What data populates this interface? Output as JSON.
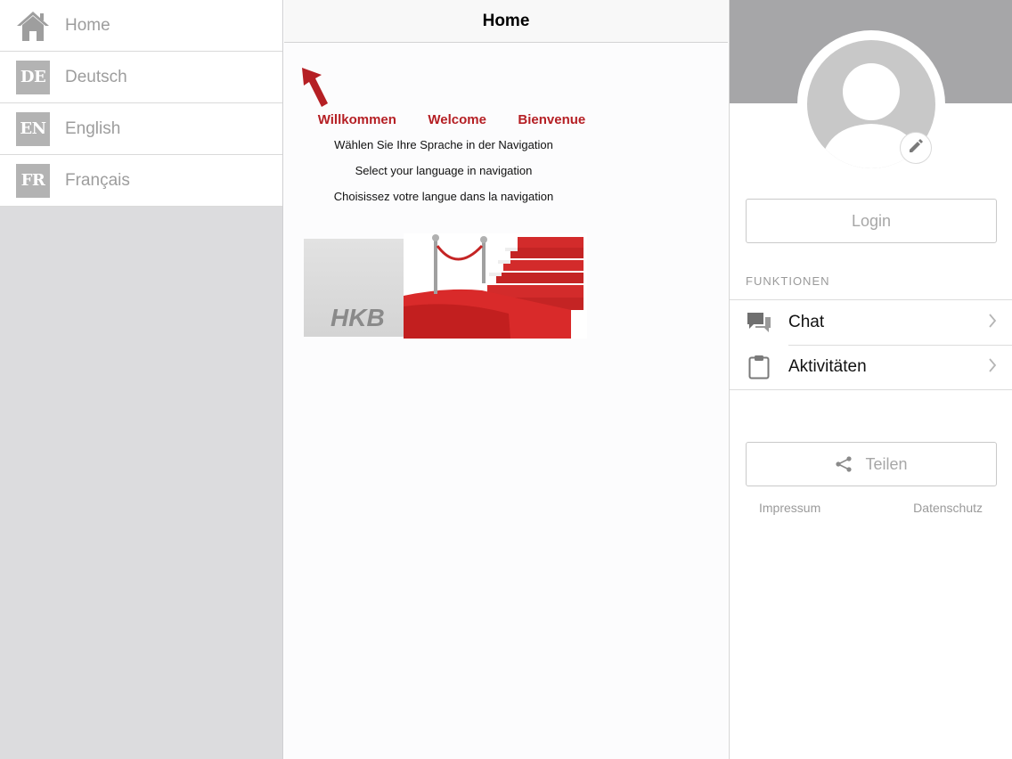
{
  "sidebar": {
    "items": [
      {
        "label": "Home",
        "icon": "home-icon"
      },
      {
        "label": "Deutsch",
        "badge": "DE"
      },
      {
        "label": "English",
        "badge": "EN"
      },
      {
        "label": "Français",
        "badge": "FR"
      }
    ]
  },
  "center": {
    "title": "Home",
    "welcome": [
      "Willkommen",
      "Welcome",
      "Bienvenue"
    ],
    "instructions": [
      "Wählen Sie Ihre Sprache in der Navigation",
      "Select your language in navigation",
      "Choisissez votre langue dans la navigation"
    ],
    "banner_logo": "HKB"
  },
  "right": {
    "login_label": "Login",
    "section_title": "FUNKTIONEN",
    "menu": [
      {
        "label": "Chat",
        "icon": "chat-icon"
      },
      {
        "label": "Aktivitäten",
        "icon": "clipboard-icon"
      }
    ],
    "share_label": "Teilen",
    "footer": {
      "impressum": "Impressum",
      "datenschutz": "Datenschutz"
    }
  },
  "colors": {
    "accent_red": "#b51f24",
    "sidebar_bg": "#dcdcde",
    "header_gray": "#a6a6a8",
    "badge_gray": "#b3b3b3",
    "muted_text": "#9d9d9d"
  }
}
